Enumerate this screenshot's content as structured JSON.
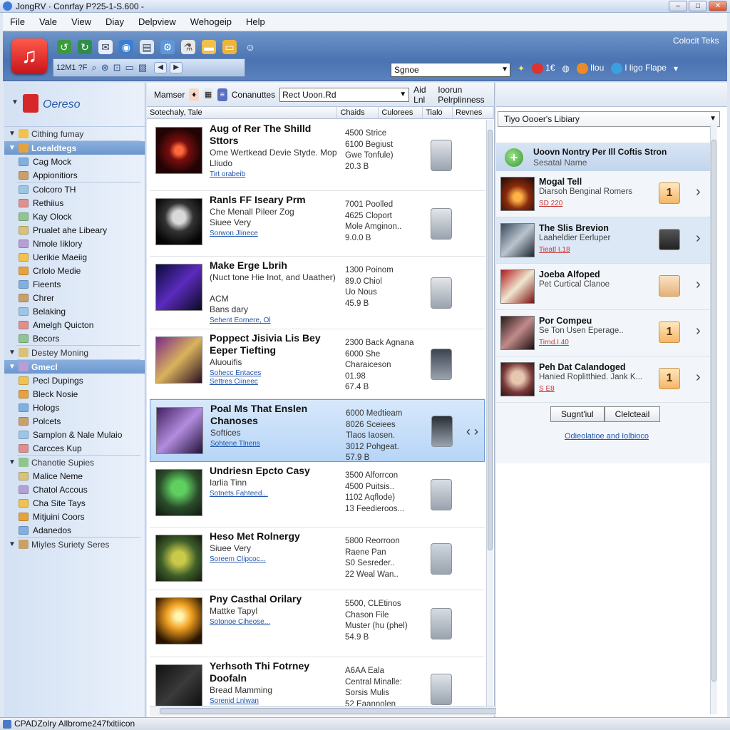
{
  "window": {
    "title": "JongRV · Conrfay P?25-1-S.600 -"
  },
  "menu": [
    "File",
    "Vale",
    "View",
    "Diay",
    "Delpview",
    "Wehogeip",
    "Help"
  ],
  "toolbar": {
    "search_text": "12M1 ?F",
    "right_label": "Colocit Teks",
    "dropdown": "Sgnoe",
    "items": [
      "1€",
      "Ilou",
      "I ligo Flape"
    ]
  },
  "sidebar": {
    "brand": "Oereso",
    "groups": [
      {
        "header": "Cithing fumay",
        "style": "plain",
        "items": []
      },
      {
        "header": "Loealdtegs",
        "style": "hl",
        "items": [
          "Cag Mock",
          "Appionitiors"
        ]
      },
      {
        "header": "",
        "style": "none",
        "items": [
          "Colcoro TH",
          "Rethiius",
          "Kay Olock",
          "Prualet ahe Libeary",
          "Nmole Iiklory",
          "Uerikie Maeiig",
          "Crlolo Medie",
          "Fieents",
          "Chrer",
          "Belaking",
          "Amelgh Quicton",
          "Becors"
        ]
      },
      {
        "header": "Destey Moning",
        "style": "plain",
        "items": []
      },
      {
        "header": "Gmecl",
        "style": "hl",
        "items": [
          "Pecl Dupings",
          "Bleck Nosie",
          "Hologs",
          "Polcets",
          "Samplon & Nale Mulaio",
          "Carcces Kup"
        ]
      },
      {
        "header": "Chanotie Supies",
        "style": "plain",
        "items": [
          "Malice Neme",
          "Chatol Accous",
          "Cha Site Tays",
          "Mitjuini Coors",
          "Adanedos"
        ]
      },
      {
        "header": "Miyles Suriety Seres",
        "style": "plain",
        "items": []
      }
    ]
  },
  "center": {
    "toolbar": {
      "label1": "Mamser",
      "label2": "Conanuttes",
      "input": "Rect Uoon.Rd",
      "aid": "Aid Lnl",
      "right": "Ioorun Pelrplinness"
    },
    "columns": [
      "Sotechaly, Tale",
      "Chaids",
      "Culorees",
      "Tialo",
      "Revnes"
    ],
    "rows": [
      {
        "title": "Aug of Rer The Shilld Sttors",
        "sub": [
          "Ome Wertkead Devie Styde. Mop Lliudo"
        ],
        "link": [
          "Tirt orabeib"
        ],
        "details": [
          "4500 Strice",
          "6100 Begiust",
          "Gwe Tonfule)",
          "20.3 B"
        ],
        "height": 100
      },
      {
        "title": "Ranls FF Iseary Prm",
        "sub": [
          "Che Menall Pileer Zog",
          "Siuee Very"
        ],
        "link": [
          "Sorwon Jlinece"
        ],
        "details": [
          "7001 Poolled",
          "4625 Cloport",
          "Mole Amginon..",
          "9.0.0 B"
        ],
        "height": 92
      },
      {
        "title": "Make Erge Lbrih",
        "sub": [
          "(Nuct tone Hie Inot, and Uaather)",
          "ACM",
          "Bans dary"
        ],
        "link": [
          "Sehent Eornere, Ol"
        ],
        "details": [
          "1300 Poinom",
          "89.0 Chiol",
          "Uo Nous",
          "45.9 B"
        ],
        "height": 102
      },
      {
        "title": "Poppect Jisivia Lis Bey Eeper Tiefting",
        "sub": [
          "Aluouifis"
        ],
        "link": [
          "Sohecc Entaces",
          "Settres Ciineec"
        ],
        "details": [
          "2300 Back Agnana",
          "6000 She",
          "Charaiceson",
          "01.98",
          "67.4 B"
        ],
        "height": 98
      },
      {
        "title": "Poal Ms That Enslen Chanoses",
        "sub": [
          "Softices"
        ],
        "link": [
          "Sohtene Tlnens"
        ],
        "details": [
          "6000 Medtieam",
          "8026 Sceiees",
          "Tlaos Iaosen.",
          "3012 Pohgeat.",
          "57.9 B"
        ],
        "height": 88
      },
      {
        "title": "Undriesn Epcto Casy",
        "sub": [
          "Iarlia Tinn"
        ],
        "link": [
          "Sotnets Fahteed..."
        ],
        "details": [
          "3500 Alforrcon",
          "4500 Puitsis..",
          "1102 Aqflode)",
          "13 Feedieroos..."
        ],
        "height": 92
      },
      {
        "title": "Heso Met Rolnergy",
        "sub": [
          "Siuee Very"
        ],
        "link": [
          "Soreem Clipcoc..."
        ],
        "details": [
          "5800 Reorroon",
          "Raene Pan",
          "S0 Sesreder..",
          "22 Weal Wan.."
        ],
        "height": 88
      },
      {
        "title": "Pny Casthal Orilary",
        "sub": [
          "Mattke Tapyl"
        ],
        "link": [
          "Sotonoe Ciheose..."
        ],
        "details": [
          "5500, CLEtinos",
          "Chason File",
          "Muster (hu (phel)",
          "54.9 B"
        ],
        "height": 94
      },
      {
        "title": "Yerhsoth Thi Fotrney Doofaln",
        "sub": [
          "Bread Mamming"
        ],
        "link": [
          "Sorenid Lnlwan"
        ],
        "details": [
          "A6AA Eala",
          "Central Minalle:",
          "Sorsis Mulis",
          "52 Eaannolen"
        ],
        "height": 90
      }
    ]
  },
  "right": {
    "dropdown": "Tiyo Oooer's Libiary",
    "panel_title": "Uoovn Nontry Per Ill Coftis Stron",
    "panel_sub": "Sesatal Name",
    "items": [
      {
        "name": "Mogal Tell",
        "sub": "Diarsoh Benginal Romers",
        "link": "SD 220",
        "badge": "1"
      },
      {
        "name": "The Slis Brevion",
        "sub": "Laaheldier Eerluper",
        "link": "Tieatl I.18",
        "badge": ""
      },
      {
        "name": "Joeba Alfoped",
        "sub": "Pet Curtical Clanoe",
        "link": "",
        "badge": ""
      },
      {
        "name": "Por Compeu",
        "sub": "Se Ton Usen Eperage..",
        "link": "Tirnd.I.40",
        "badge": "1"
      },
      {
        "name": "Peh Dat Calandoged",
        "sub": "Hanied Roplitthied. Jank K...",
        "link": "S E8",
        "badge": "1"
      }
    ],
    "btn1": "Sugnt'iul",
    "btn2": "Clelcteail",
    "link": "Odieolatioe and Iolbioco"
  },
  "status": "CPADZolry Allbrome247fxitiicon",
  "colors": {
    "accent": "#4a73b2",
    "selection": "#b7d5f7"
  }
}
